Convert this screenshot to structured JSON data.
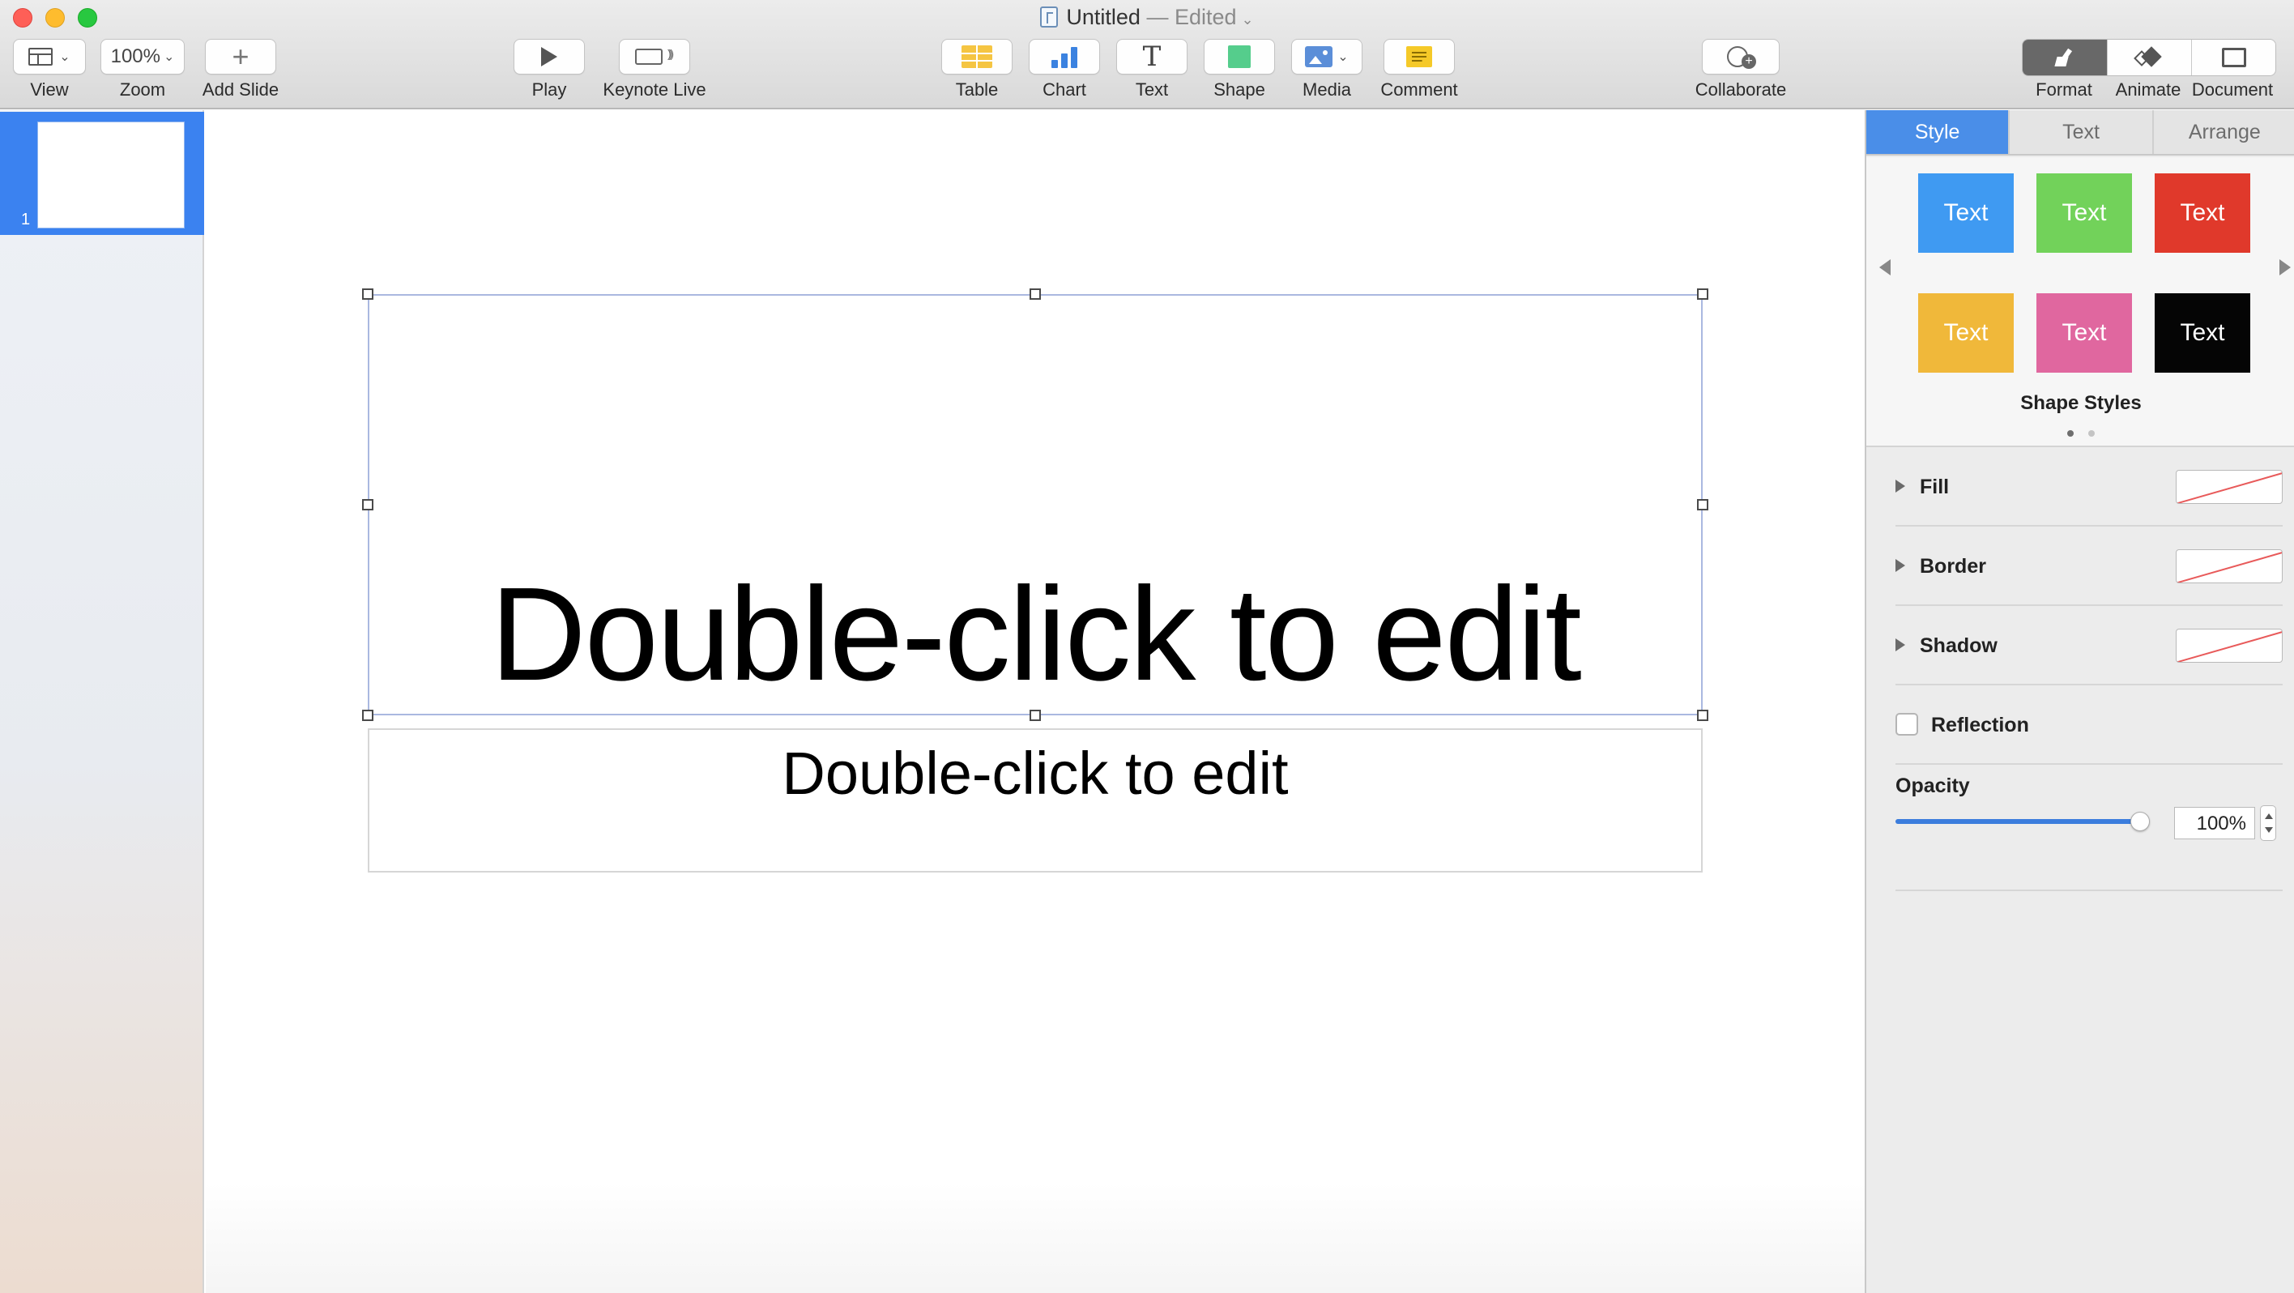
{
  "window": {
    "title": "Untitled",
    "status": "— Edited",
    "status_chevron": "chevron-down-icon"
  },
  "toolbar": {
    "view_label": "View",
    "zoom_value": "100%",
    "zoom_label": "Zoom",
    "add_slide_label": "Add Slide",
    "play_label": "Play",
    "keynote_live_label": "Keynote Live",
    "table_label": "Table",
    "chart_label": "Chart",
    "text_label": "Text",
    "shape_label": "Shape",
    "media_label": "Media",
    "comment_label": "Comment",
    "collaborate_label": "Collaborate",
    "format_label": "Format",
    "animate_label": "Animate",
    "document_label": "Document",
    "active_panel": "Format",
    "icons": [
      "view-icon",
      "zoom-chevron-icon",
      "plus-icon",
      "play-icon",
      "keynote-live-icon",
      "table-icon",
      "chart-icon",
      "text-icon",
      "shape-icon",
      "media-icon",
      "comment-icon",
      "collaborate-icon",
      "format-brush-icon",
      "animate-icon",
      "document-icon"
    ]
  },
  "navigator": {
    "slides": [
      {
        "number": "1",
        "selected": true
      }
    ],
    "selection_color": "#3b82f0"
  },
  "slide": {
    "title_placeholder": "Double-click to edit",
    "subtitle_placeholder": "Double-click to edit",
    "title_selected": true
  },
  "inspector": {
    "tabs": [
      {
        "label": "Style",
        "active": true
      },
      {
        "label": "Text",
        "active": false
      },
      {
        "label": "Arrange",
        "active": false
      }
    ],
    "shape_styles": [
      {
        "label": "Text",
        "color": "#3f9af2"
      },
      {
        "label": "Text",
        "color": "#72d25a"
      },
      {
        "label": "Text",
        "color": "#e0392b"
      },
      {
        "label": "Text",
        "color": "#f0b83a"
      },
      {
        "label": "Text",
        "color": "#e0679f"
      },
      {
        "label": "Text",
        "color": "#050505"
      }
    ],
    "shape_styles_label": "Shape Styles",
    "style_pages": 2,
    "style_page_current": 1,
    "fill_label": "Fill",
    "border_label": "Border",
    "shadow_label": "Shadow",
    "reflection_label": "Reflection",
    "reflection_checked": false,
    "opacity_label": "Opacity",
    "opacity_value": "100%",
    "opacity_level": 1.0,
    "accent_color": "#4a8ee8"
  }
}
